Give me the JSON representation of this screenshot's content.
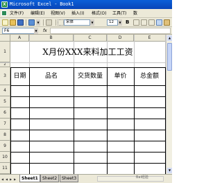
{
  "window": {
    "title": "Microsoft Excel - Book1"
  },
  "menu": {
    "items": [
      "文件(F)",
      "编辑(E)",
      "视图(V)",
      "插入(I)",
      "格式(O)",
      "工具(T)",
      "数"
    ]
  },
  "toolbar": {
    "font_name": "宋体",
    "font_size": "12",
    "bold": "B"
  },
  "formula": {
    "cell_ref": "F6",
    "fx": "fx",
    "value": ""
  },
  "columns": [
    "A",
    "B",
    "C",
    "D",
    "E"
  ],
  "rows": [
    "1",
    "2",
    "3",
    "4",
    "5",
    "6",
    "7",
    "8",
    "9",
    "10",
    "11"
  ],
  "sheet": {
    "title": "X月份XXX来料加工工资",
    "headers": [
      "日期",
      "品名",
      "交货数量",
      "单价",
      "总金额"
    ]
  },
  "tabs": [
    "Sheet1",
    "Sheet2",
    "Sheet3"
  ],
  "active_tab": "Sheet1",
  "watermark": "Bai经验"
}
